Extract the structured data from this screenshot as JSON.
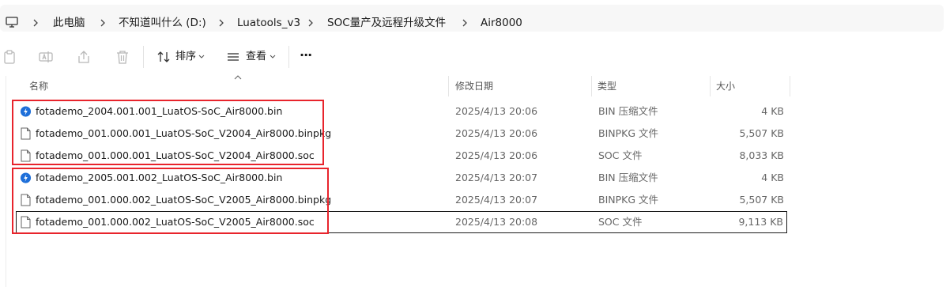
{
  "breadcrumb": {
    "items": [
      "此电脑",
      "不知道叫什么 (D:)",
      "Luatools_v3",
      "SOC量产及远程升级文件",
      "Air8000"
    ]
  },
  "toolbar": {
    "sort_label": "排序",
    "view_label": "查看",
    "more_label": "···"
  },
  "columns": {
    "name": "名称",
    "modified": "修改日期",
    "type": "类型",
    "size": "大小"
  },
  "files": [
    {
      "name": "fotademo_2004.001.001_LuatOS-SoC_Air8000.bin",
      "modified": "2025/4/13 20:06",
      "type": "BIN 压缩文件",
      "size": "4 KB",
      "icon": "bin-archive-icon"
    },
    {
      "name": "fotademo_001.000.001_LuatOS-SoC_V2004_Air8000.binpkg",
      "modified": "2025/4/13 20:06",
      "type": "BINPKG 文件",
      "size": "5,507 KB",
      "icon": "generic-file-icon"
    },
    {
      "name": "fotademo_001.000.001_LuatOS-SoC_V2004_Air8000.soc",
      "modified": "2025/4/13 20:06",
      "type": "SOC 文件",
      "size": "8,033 KB",
      "icon": "generic-file-icon"
    },
    {
      "name": "fotademo_2005.001.002_LuatOS-SoC_Air8000.bin",
      "modified": "2025/4/13 20:07",
      "type": "BIN 压缩文件",
      "size": "4 KB",
      "icon": "bin-archive-icon"
    },
    {
      "name": "fotademo_001.000.002_LuatOS-SoC_V2005_Air8000.binpkg",
      "modified": "2025/4/13 20:07",
      "type": "BINPKG 文件",
      "size": "5,507 KB",
      "icon": "generic-file-icon"
    },
    {
      "name": "fotademo_001.000.002_LuatOS-SoC_V2005_Air8000.soc",
      "modified": "2025/4/13 20:08",
      "type": "SOC 文件",
      "size": "9,113 KB",
      "icon": "generic-file-icon",
      "selected": true
    }
  ],
  "colors": {
    "highlight_box": "#e8242c",
    "selection_border": "#1a1a1a",
    "bin_icon": "#1e6fd9"
  }
}
